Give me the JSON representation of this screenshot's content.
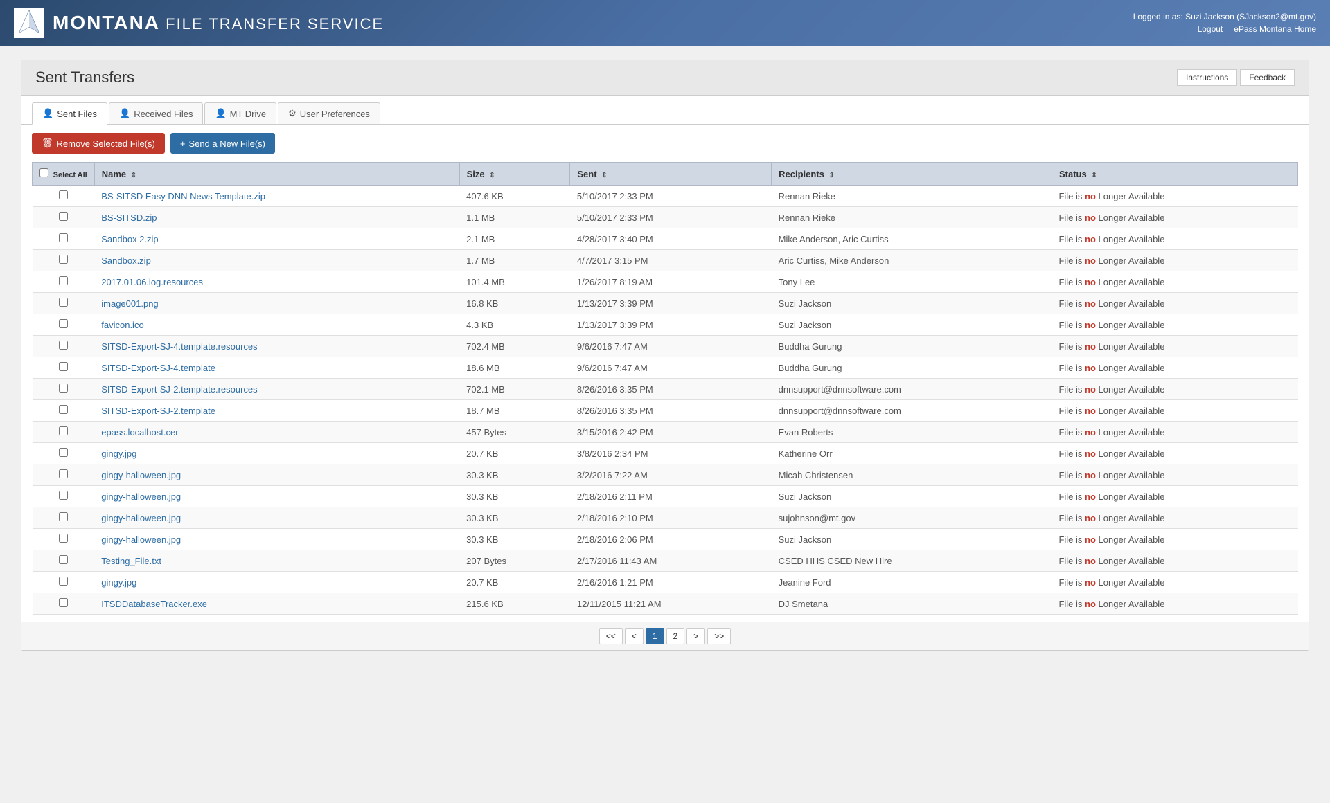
{
  "header": {
    "brand_bold": "MONTANA",
    "brand_thin": " FILE TRANSFER SERVICE",
    "logged_in_label": "Logged in as: Suzi Jackson (SJackson2@mt.gov)",
    "logout_label": "Logout",
    "epass_label": "ePass Montana Home"
  },
  "page": {
    "title": "Sent Transfers",
    "instructions_label": "Instructions",
    "feedback_label": "Feedback"
  },
  "tabs": [
    {
      "id": "sent-files",
      "label": "Sent Files",
      "icon": "👤",
      "active": true
    },
    {
      "id": "received-files",
      "label": "Received Files",
      "icon": "👤"
    },
    {
      "id": "mt-drive",
      "label": "MT Drive",
      "icon": "👤"
    },
    {
      "id": "user-preferences",
      "label": "User Preferences",
      "icon": "⚙"
    }
  ],
  "actions": {
    "remove_label": "Remove Selected File(s)",
    "send_label": "Send a New File(s)"
  },
  "table": {
    "select_all_label": "Select All",
    "columns": [
      "Name",
      "Size",
      "Sent",
      "Recipients",
      "Status"
    ],
    "rows": [
      {
        "name": "BS-SITSD Easy DNN News Template.zip",
        "size": "407.6 KB",
        "sent": "5/10/2017 2:33 PM",
        "recipients": "Rennan Rieke",
        "status": "File is no Longer Available"
      },
      {
        "name": "BS-SITSD.zip",
        "size": "1.1 MB",
        "sent": "5/10/2017 2:33 PM",
        "recipients": "Rennan Rieke",
        "status": "File is no Longer Available"
      },
      {
        "name": "Sandbox 2.zip",
        "size": "2.1 MB",
        "sent": "4/28/2017 3:40 PM",
        "recipients": "Mike Anderson, Aric Curtiss",
        "status": "File is no Longer Available"
      },
      {
        "name": "Sandbox.zip",
        "size": "1.7 MB",
        "sent": "4/7/2017 3:15 PM",
        "recipients": "Aric Curtiss, Mike Anderson",
        "status": "File is no Longer Available"
      },
      {
        "name": "2017.01.06.log.resources",
        "size": "101.4 MB",
        "sent": "1/26/2017 8:19 AM",
        "recipients": "Tony Lee",
        "status": "File is no Longer Available"
      },
      {
        "name": "image001.png",
        "size": "16.8 KB",
        "sent": "1/13/2017 3:39 PM",
        "recipients": "Suzi Jackson",
        "status": "File is no Longer Available"
      },
      {
        "name": "favicon.ico",
        "size": "4.3 KB",
        "sent": "1/13/2017 3:39 PM",
        "recipients": "Suzi Jackson",
        "status": "File is no Longer Available"
      },
      {
        "name": "SITSD-Export-SJ-4.template.resources",
        "size": "702.4 MB",
        "sent": "9/6/2016 7:47 AM",
        "recipients": "Buddha Gurung",
        "status": "File is no Longer Available"
      },
      {
        "name": "SITSD-Export-SJ-4.template",
        "size": "18.6 MB",
        "sent": "9/6/2016 7:47 AM",
        "recipients": "Buddha Gurung",
        "status": "File is no Longer Available"
      },
      {
        "name": "SITSD-Export-SJ-2.template.resources",
        "size": "702.1 MB",
        "sent": "8/26/2016 3:35 PM",
        "recipients": "dnnsupport@dnnsoftware.com",
        "status": "File is no Longer Available"
      },
      {
        "name": "SITSD-Export-SJ-2.template",
        "size": "18.7 MB",
        "sent": "8/26/2016 3:35 PM",
        "recipients": "dnnsupport@dnnsoftware.com",
        "status": "File is no Longer Available"
      },
      {
        "name": "epass.localhost.cer",
        "size": "457 Bytes",
        "sent": "3/15/2016 2:42 PM",
        "recipients": "Evan Roberts",
        "status": "File is no Longer Available"
      },
      {
        "name": "gingy.jpg",
        "size": "20.7 KB",
        "sent": "3/8/2016 2:34 PM",
        "recipients": "Katherine Orr",
        "status": "File is no Longer Available"
      },
      {
        "name": "gingy-halloween.jpg",
        "size": "30.3 KB",
        "sent": "3/2/2016 7:22 AM",
        "recipients": "Micah Christensen",
        "status": "File is no Longer Available"
      },
      {
        "name": "gingy-halloween.jpg",
        "size": "30.3 KB",
        "sent": "2/18/2016 2:11 PM",
        "recipients": "Suzi Jackson",
        "status": "File is no Longer Available"
      },
      {
        "name": "gingy-halloween.jpg",
        "size": "30.3 KB",
        "sent": "2/18/2016 2:10 PM",
        "recipients": "sujohnson@mt.gov",
        "status": "File is no Longer Available"
      },
      {
        "name": "gingy-halloween.jpg",
        "size": "30.3 KB",
        "sent": "2/18/2016 2:06 PM",
        "recipients": "Suzi Jackson",
        "status": "File is no Longer Available"
      },
      {
        "name": "Testing_File.txt",
        "size": "207 Bytes",
        "sent": "2/17/2016 11:43 AM",
        "recipients": "CSED HHS CSED New Hire",
        "status": "File is no Longer Available"
      },
      {
        "name": "gingy.jpg",
        "size": "20.7 KB",
        "sent": "2/16/2016 1:21 PM",
        "recipients": "Jeanine Ford",
        "status": "File is no Longer Available"
      },
      {
        "name": "ITSDDatabaseTracker.exe",
        "size": "215.6 KB",
        "sent": "12/11/2015 11:21 AM",
        "recipients": "DJ Smetana",
        "status": "File is no Longer Available"
      }
    ]
  },
  "pagination": {
    "first_label": "<<",
    "prev_label": "<",
    "next_label": ">",
    "last_label": ">>",
    "pages": [
      "1",
      "2"
    ],
    "current_page": "1"
  },
  "status_prefix": "File is ",
  "status_highlight": "no",
  "status_suffix": " Longer Available"
}
